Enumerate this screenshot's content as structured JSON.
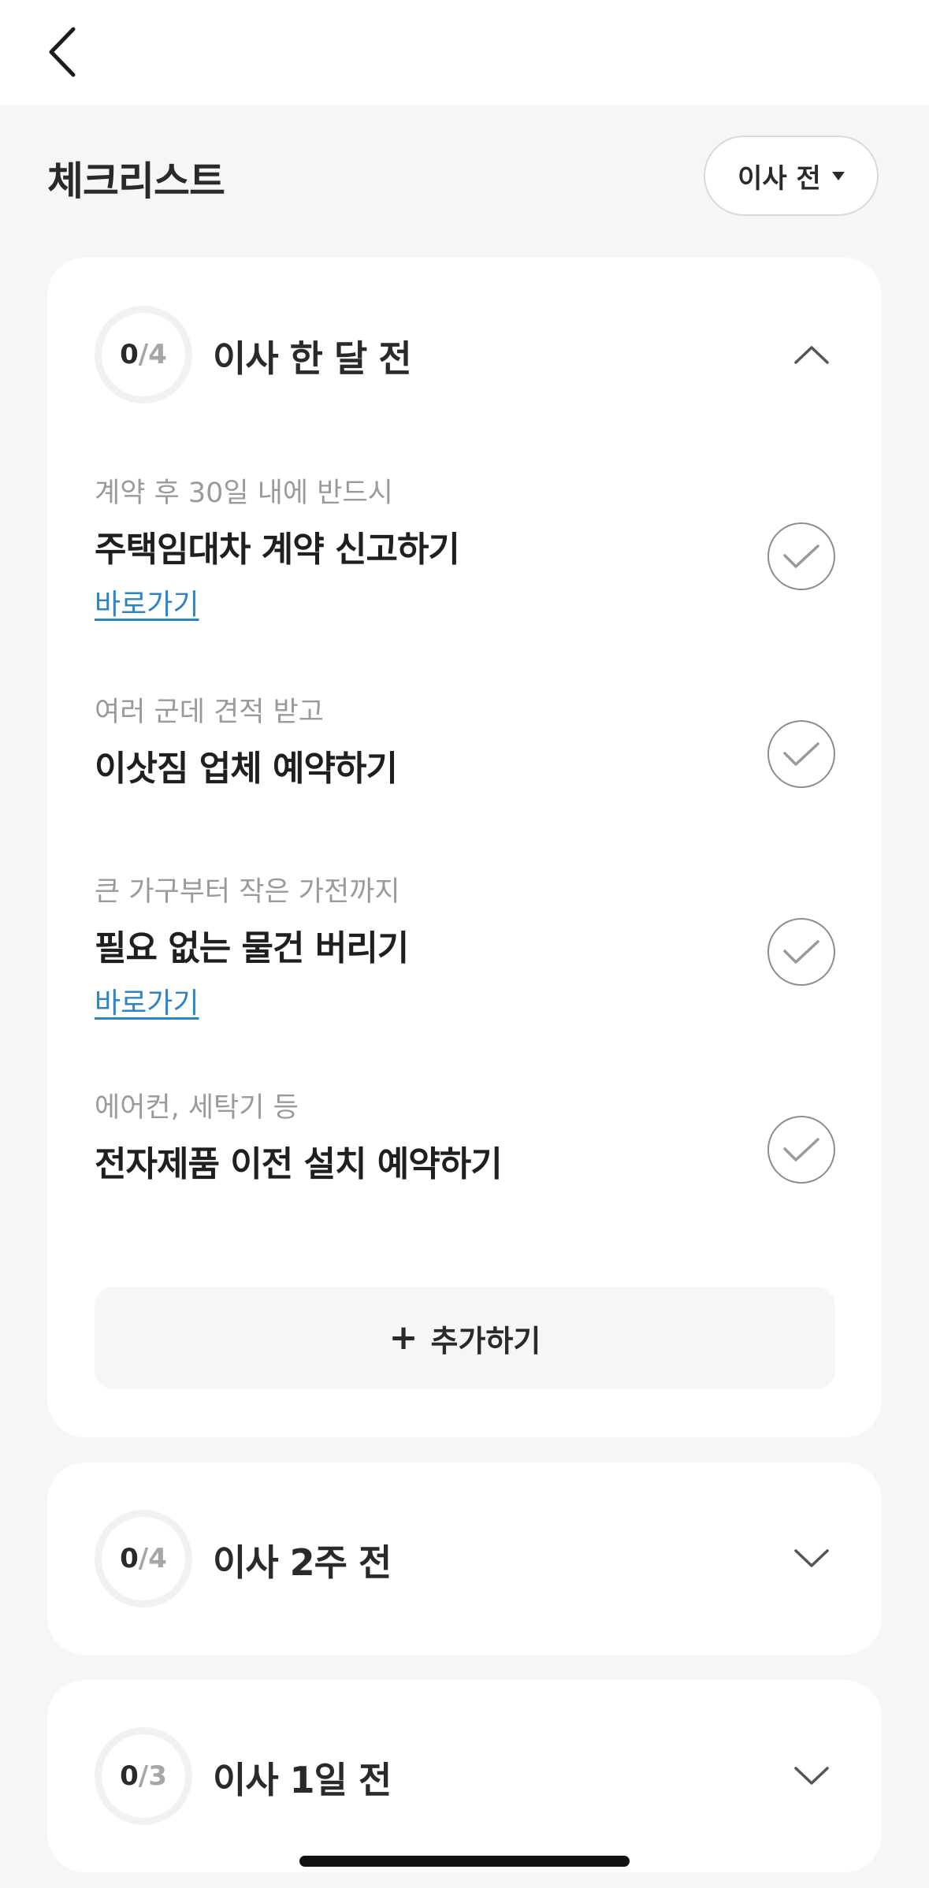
{
  "header": {
    "page_title": "체크리스트",
    "stage_selector": "이사 전"
  },
  "sections": [
    {
      "done": "0",
      "total": "4",
      "title": "이사 한 달 전",
      "expanded": true,
      "items": [
        {
          "subtitle": "계약 후 30일 내에 반드시",
          "title": "주택임대차 계약 신고하기",
          "link": "바로가기",
          "checked": false
        },
        {
          "subtitle": "여러 군데 견적 받고",
          "title": "이삿짐 업체 예약하기",
          "checked": false
        },
        {
          "subtitle": "큰 가구부터 작은 가전까지",
          "title": "필요 없는 물건 버리기",
          "link": "바로가기",
          "checked": false
        },
        {
          "subtitle": "에어컨, 세탁기 등",
          "title": "전자제품 이전 설치 예약하기",
          "checked": false
        }
      ],
      "add_label": "추가하기",
      "add_icon": "plus-icon"
    },
    {
      "done": "0",
      "total": "4",
      "title": "이사 2주 전",
      "expanded": false
    },
    {
      "done": "0",
      "total": "3",
      "title": "이사 1일 전",
      "expanded": false
    }
  ],
  "icons": {
    "back": "chevron-left-icon",
    "expanded": "chevron-up-icon",
    "collapsed": "chevron-down-icon",
    "check": "check-icon",
    "dropdown": "caret-down-icon"
  },
  "colors": {
    "background": "#f6f6f6",
    "card": "#ffffff",
    "link": "#2c83c6",
    "muted_text": "#9a9a9a",
    "check_stroke": "#8c8c8c"
  }
}
